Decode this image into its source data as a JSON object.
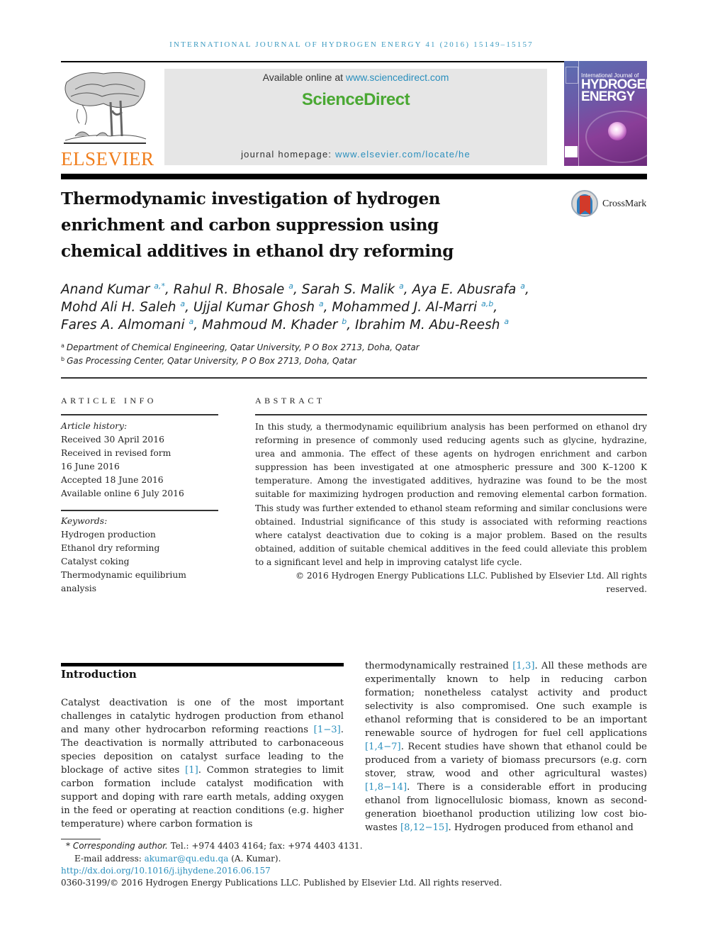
{
  "running_head": "INTERNATIONAL JOURNAL OF HYDROGEN ENERGY 41 (2016) 15149–15157",
  "masthead": {
    "publisher_logo_text": "ELSEVIER",
    "available_online_prefix": "Available online at ",
    "available_online_link": "www.sciencedirect.com",
    "sciencedirect_brand": "ScienceDirect",
    "journal_homepage_prefix": "journal homepage: ",
    "journal_homepage_link": "www.elsevier.com/locate/he",
    "cover": {
      "line1": "International Journal of",
      "line2": "HYDROGEN",
      "line3": "ENERGY"
    },
    "colors": {
      "elsevier_orange": "#f07f1e",
      "sciencedirect_green": "#4aa833",
      "link_blue": "#2a8fbd"
    }
  },
  "article": {
    "title_lines": [
      "Thermodynamic investigation of hydrogen",
      "enrichment and carbon suppression using",
      "chemical additives in ethanol dry reforming"
    ],
    "crossmark_label": "CrossMark",
    "authors": [
      {
        "name": "Anand Kumar",
        "sup": "a,*"
      },
      {
        "name": "Rahul R. Bhosale",
        "sup": "a"
      },
      {
        "name": "Sarah S. Malik",
        "sup": "a"
      },
      {
        "name": "Aya E. Abusrafa",
        "sup": "a"
      },
      {
        "name": "Mohd Ali H. Saleh",
        "sup": "a"
      },
      {
        "name": "Ujjal Kumar Ghosh",
        "sup": "a"
      },
      {
        "name": "Mohammed J. Al-Marri",
        "sup": "a,b"
      },
      {
        "name": "Fares A. Almomani",
        "sup": "a"
      },
      {
        "name": "Mahmoud M. Khader",
        "sup": "b"
      },
      {
        "name": "Ibrahim M. Abu-Reesh",
        "sup": "a"
      }
    ],
    "affiliations": [
      {
        "label": "a",
        "text": "Department of Chemical Engineering, Qatar University, P O Box 2713, Doha, Qatar"
      },
      {
        "label": "b",
        "text": "Gas Processing Center, Qatar University, P O Box 2713, Doha, Qatar"
      }
    ]
  },
  "article_info": {
    "heading": "ARTICLE INFO",
    "history_label": "Article history:",
    "history": [
      "Received 30 April 2016",
      "Received in revised form",
      "16 June 2016",
      "Accepted 18 June 2016",
      "Available online 6 July 2016"
    ],
    "keywords_label": "Keywords:",
    "keywords": [
      "Hydrogen production",
      "Ethanol dry reforming",
      "Catalyst coking",
      "Thermodynamic equilibrium",
      "analysis"
    ]
  },
  "abstract": {
    "heading": "ABSTRACT",
    "text": "In this study, a thermodynamic equilibrium analysis has been performed on ethanol dry reforming in presence of commonly used reducing agents such as glycine, hydrazine, urea and ammonia. The effect of these agents on hydrogen enrichment and carbon suppression has been investigated at one atmospheric pressure and 300 K–1200 K temperature. Among the investigated additives, hydrazine was found to be the most suitable for maximizing hydrogen production and removing elemental carbon formation. This study was further extended to ethanol steam reforming and similar conclusions were obtained. Industrial significance of this study is associated with reforming reactions where catalyst deactivation due to coking is a major problem. Based on the results obtained, addition of suitable chemical additives in the feed could alleviate this problem to a significant level and help in improving catalyst life cycle.",
    "copyright": "© 2016 Hydrogen Energy Publications LLC. Published by Elsevier Ltd. All rights reserved."
  },
  "introduction": {
    "heading": "Introduction",
    "left": [
      {
        "t": "Catalyst deactivation is one of the most important challenges in catalytic hydrogen production from ethanol and many other hydrocarbon reforming reactions "
      },
      {
        "ref": "[1−3]"
      },
      {
        "t": ". The deactivation is normally attributed to carbonaceous species deposition on catalyst surface leading to the blockage of active sites "
      },
      {
        "ref": "[1]"
      },
      {
        "t": ". Common strategies to limit carbon formation include catalyst modification with support and doping with rare earth metals, adding oxygen in the feed or operating at reaction conditions (e.g. higher temperature) where carbon formation is"
      }
    ],
    "right": [
      {
        "t": "thermodynamically restrained "
      },
      {
        "ref": "[1,3]"
      },
      {
        "t": ". All these methods are experimentally known to help in reducing carbon formation; nonetheless catalyst activity and product selectivity is also compromised. One such example is ethanol reforming that is considered to be an important renewable source of hydrogen for fuel cell applications "
      },
      {
        "ref": "[1,4−7]"
      },
      {
        "t": ". Recent studies have shown that ethanol could be produced from a variety of biomass precursors (e.g. corn stover, straw, wood and other agricultural wastes) "
      },
      {
        "ref": "[1,8−14]"
      },
      {
        "t": ". There is a considerable effort in producing ethanol from lignocellulosic biomass, known as second-generation bioethanol production utilizing low cost bio-wastes "
      },
      {
        "ref": "[8,12−15]"
      },
      {
        "t": ". Hydrogen produced from ethanol and"
      }
    ]
  },
  "footnotes": {
    "corresponding_marker": "*",
    "corresponding_label": "Corresponding author.",
    "contact": " Tel.: +974 4403 4164; fax: +974 4403 4131.",
    "email_label": "E-mail address: ",
    "email": "akumar@qu.edu.qa",
    "email_suffix": " (A. Kumar).",
    "doi": "http://dx.doi.org/10.1016/j.ijhydene.2016.06.157",
    "issn_copyright": "0360-3199/© 2016 Hydrogen Energy Publications LLC. Published by Elsevier Ltd. All rights reserved."
  }
}
